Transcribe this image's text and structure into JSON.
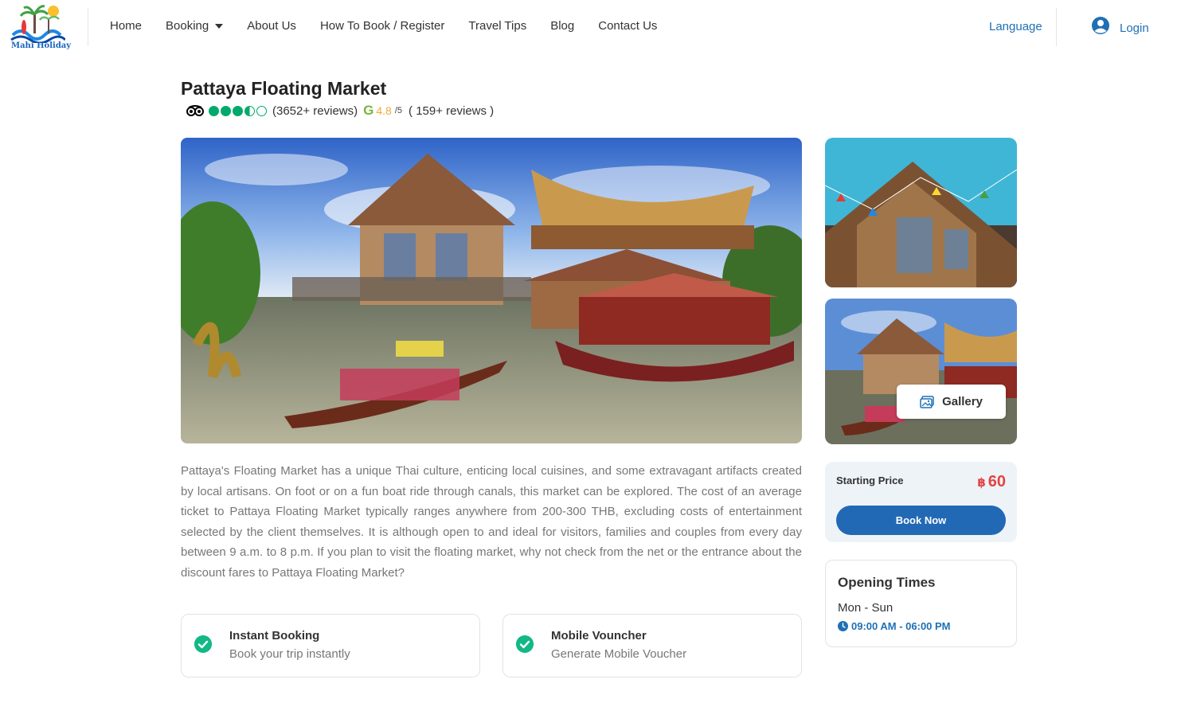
{
  "header": {
    "logo_text": "Mahi Holiday",
    "nav": [
      {
        "label": "Home"
      },
      {
        "label": "Booking",
        "has_dropdown": true
      },
      {
        "label": "About Us"
      },
      {
        "label": "How To Book / Register"
      },
      {
        "label": "Travel Tips"
      },
      {
        "label": "Blog"
      },
      {
        "label": "Contact Us"
      }
    ],
    "language_label": "Language",
    "login_label": "Login",
    "accent_color": "#1e70b5"
  },
  "attraction": {
    "title": "Pattaya Floating Market",
    "tripadvisor": {
      "icon": "tripadvisor-owl-icon",
      "bubble_rating": 3.5,
      "reviews_text": "(3652+ reviews)"
    },
    "google": {
      "icon": "google-g-icon",
      "score": "4.8",
      "scale": "/5",
      "reviews_text": "( 159+ reviews )"
    },
    "gallery_label": "Gallery",
    "description": "Pattaya's Floating Market has a unique Thai culture, enticing local cuisines, and some extravagant artifacts created by local artisans. On foot or on a fun boat ride through canals, this market can be explored. The cost of an average ticket to Pattaya Floating Market typically ranges anywhere from 200-300 THB, excluding costs of entertainment selected by the client themselves. It is although open to and ideal for visitors, families and couples from every day between 9 a.m. to 8 p.m. If you plan to visit the floating market, why not check from the net or the entrance about the discount fares to Pattaya Floating Market?"
  },
  "features": [
    {
      "title": "Instant Booking",
      "subtitle": "Book your trip instantly"
    },
    {
      "title": "Mobile Vouncher",
      "subtitle": "Generate Mobile Voucher"
    }
  ],
  "price": {
    "label": "Starting Price",
    "currency": "฿",
    "amount": "60",
    "button_label": "Book Now",
    "price_color": "#e04545",
    "button_color": "#2269b5"
  },
  "opening": {
    "title": "Opening Times",
    "days": "Mon - Sun",
    "hours": "09:00 AM - 06:00 PM"
  }
}
